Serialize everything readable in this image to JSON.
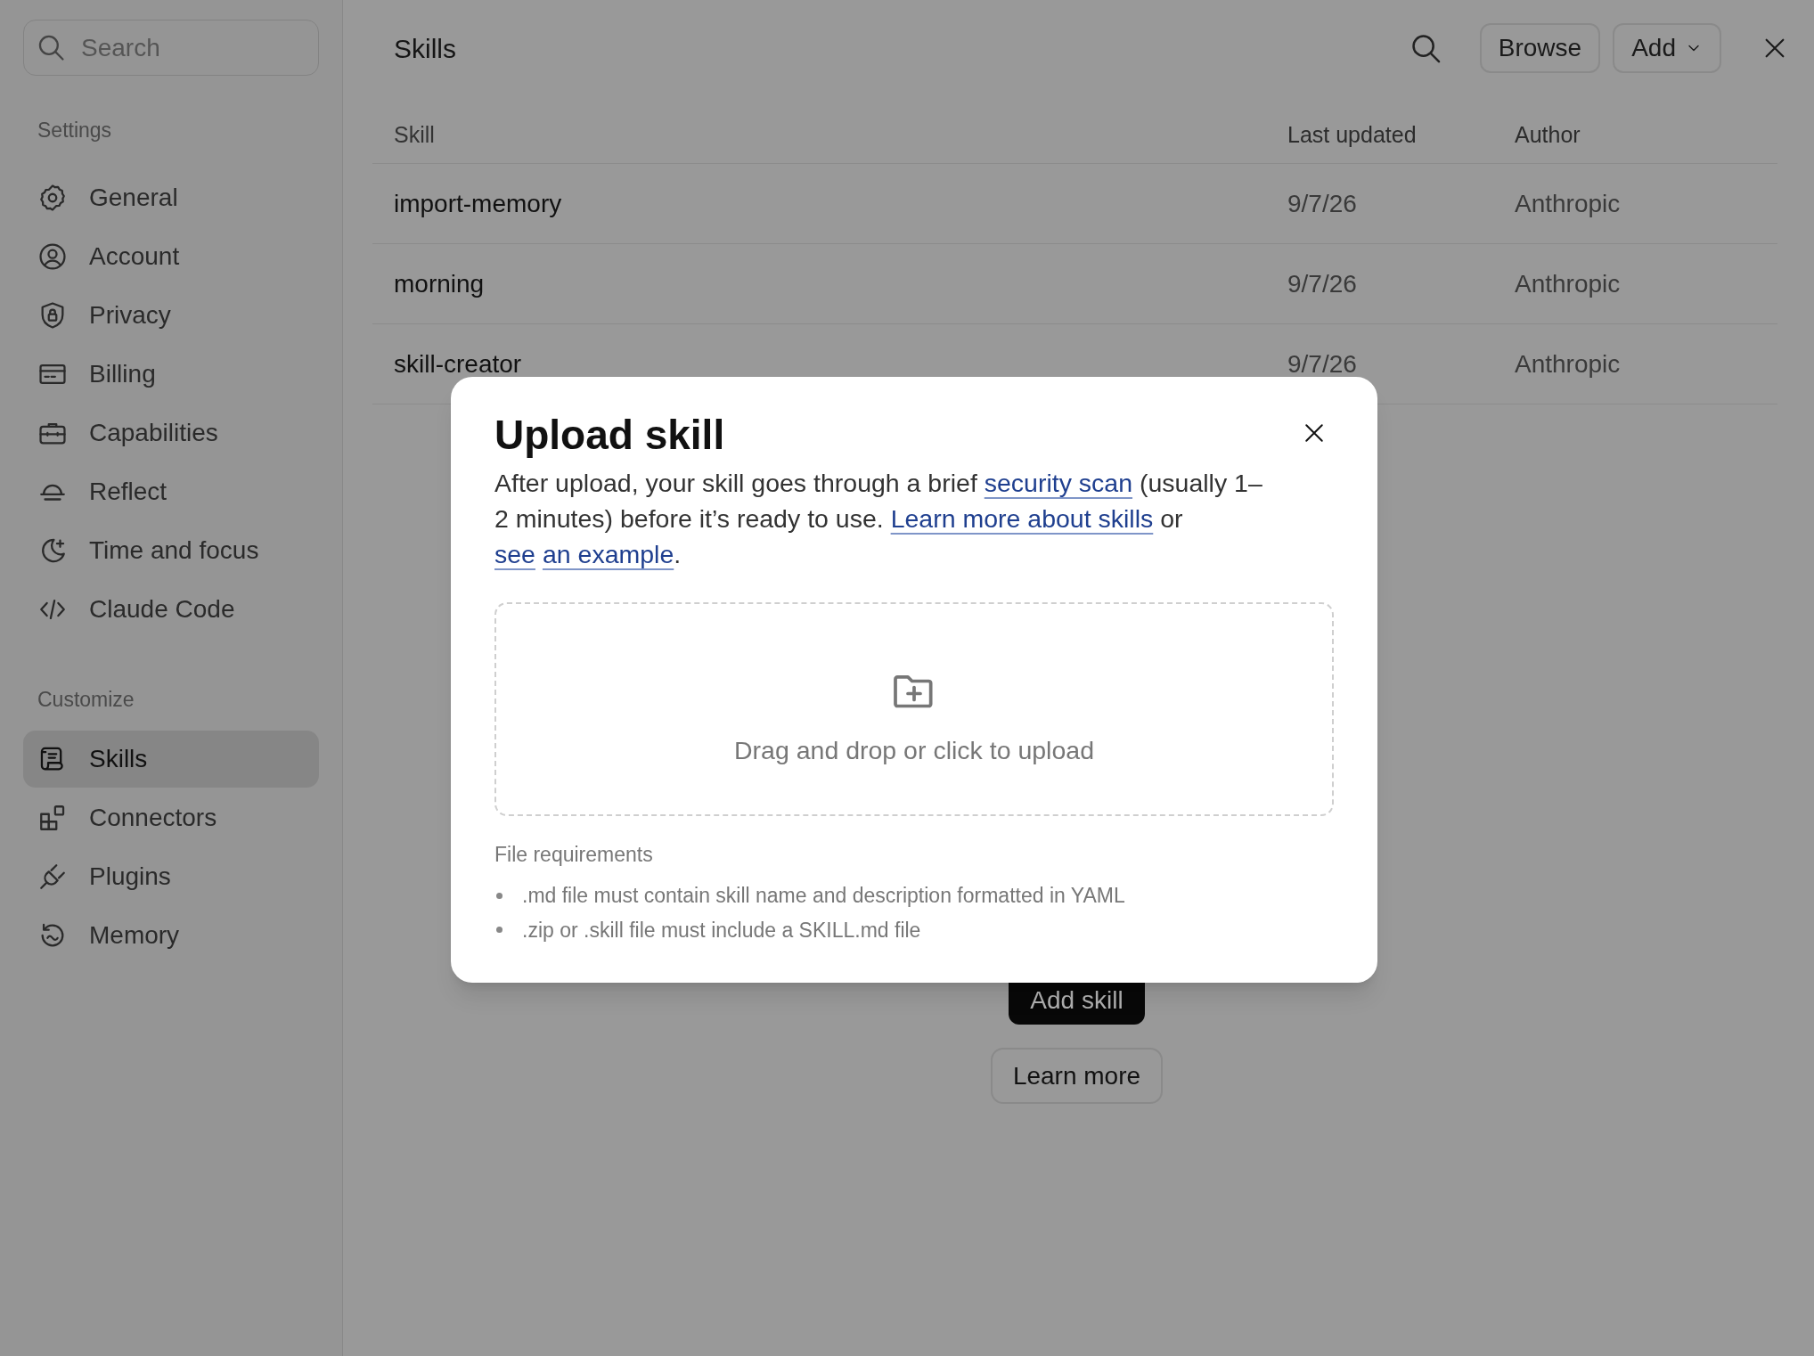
{
  "sidebar": {
    "search": {
      "placeholder": "Search"
    },
    "sections": [
      {
        "heading": "Settings",
        "items": [
          {
            "label": "General",
            "selected": false
          },
          {
            "label": "Account",
            "selected": false
          },
          {
            "label": "Privacy",
            "selected": false
          },
          {
            "label": "Billing",
            "selected": false
          },
          {
            "label": "Capabilities",
            "selected": false
          },
          {
            "label": "Reflect",
            "selected": false
          },
          {
            "label": "Time and focus",
            "selected": false
          },
          {
            "label": "Claude Code",
            "selected": false
          }
        ]
      },
      {
        "heading": "Customize",
        "items": [
          {
            "label": "Skills",
            "selected": true
          },
          {
            "label": "Connectors",
            "selected": false
          },
          {
            "label": "Plugins",
            "selected": false
          },
          {
            "label": "Memory",
            "selected": false
          }
        ]
      }
    ]
  },
  "header": {
    "title": "Skills",
    "buttons": [
      {
        "label": "Browse",
        "kind": "plain"
      },
      {
        "label": "Add",
        "kind": "dropdown"
      }
    ]
  },
  "table": {
    "columns": [
      "Skill",
      "Last updated",
      "Author"
    ],
    "rows": [
      [
        "import-memory",
        "9/7/26",
        "Anthropic"
      ],
      [
        "morning",
        "9/7/26",
        "Anthropic"
      ],
      [
        "skill-creator",
        "9/7/26",
        "Anthropic"
      ]
    ]
  },
  "empty_state": {
    "buttons": [
      {
        "label": "Add skill",
        "kind": "primary"
      },
      {
        "label": "Learn more",
        "kind": "secondary"
      }
    ]
  },
  "modal": {
    "title": "Upload skill",
    "description": [
      {
        "kind": "text",
        "text": "After upload, your skill goes through a brief "
      },
      {
        "kind": "link",
        "text": "security scan"
      },
      {
        "kind": "text",
        "text": " (usually 1–2 minutes) before it’s ready to use. "
      },
      {
        "kind": "link",
        "text": "Learn more about skills"
      },
      {
        "kind": "text",
        "text": " or "
      },
      {
        "kind": "link",
        "text": "see"
      },
      {
        "kind": "link",
        "text": "an example"
      },
      {
        "kind": "text",
        "text": "."
      }
    ],
    "dropzone": {
      "label": "Drag and drop or click to upload"
    },
    "requirements": {
      "heading": "File requirements",
      "items": [
        ".md file must contain skill name and description formatted in YAML",
        ".zip or .skill file must include a SKILL.md file"
      ]
    }
  }
}
